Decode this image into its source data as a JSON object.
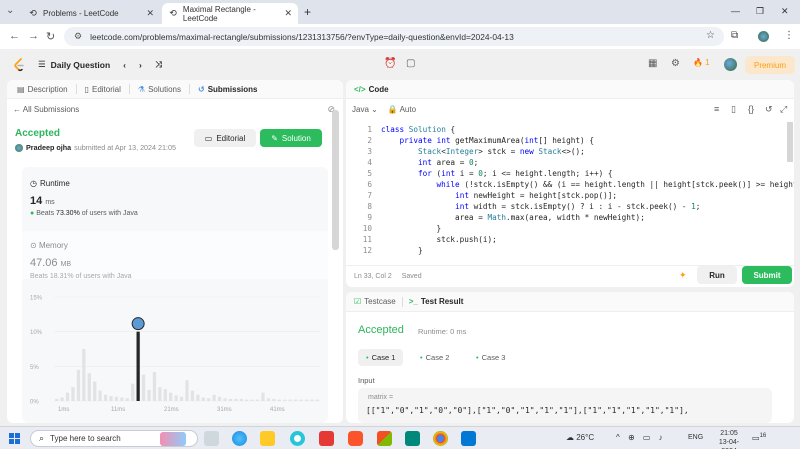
{
  "browser": {
    "tabs": [
      {
        "title": "Problems - LeetCode",
        "close": "✕"
      },
      {
        "title": "Maximal Rectangle - LeetCode",
        "close": "✕"
      }
    ],
    "new_tab": "+",
    "url": "leetcode.com/problems/maximal-rectangle/submissions/1231313756/?envType=daily-question&envId=2024-04-13"
  },
  "header": {
    "title": "Daily Question",
    "streak": "1",
    "premium": "Premium"
  },
  "left": {
    "tabs": [
      "Description",
      "Editorial",
      "Solutions",
      "Submissions"
    ],
    "all_submissions": "All Submissions",
    "status": "Accepted",
    "user": "Pradeep ojha",
    "submitted": "submitted at Apr 13, 2024 21:05",
    "editorial_btn": "Editorial",
    "solution_btn": "Solution",
    "runtime_label": "Runtime",
    "runtime_value": "14",
    "runtime_unit": "ms",
    "runtime_beats_prefix": "Beats",
    "runtime_beats_pct": "73.30%",
    "runtime_beats_suffix": "of users with Java",
    "memory_label": "Memory",
    "memory_value": "47.06",
    "memory_unit": "MB",
    "memory_beats": "Beats 18.31% of users with Java"
  },
  "chart_data": {
    "type": "bar",
    "y_ticks": [
      "15%",
      "10%",
      "5%",
      "0%"
    ],
    "ylim": [
      0,
      15
    ],
    "x_ticks": [
      "1ms",
      "11ms",
      "21ms",
      "31ms",
      "41ms"
    ],
    "values": [
      0.3,
      0.5,
      1.2,
      2.0,
      4.5,
      7.5,
      4.0,
      2.8,
      1.5,
      0.9,
      0.7,
      0.6,
      0.5,
      0.4,
      2.5,
      10.0,
      3.8,
      1.6,
      4.2,
      2.0,
      1.7,
      1.2,
      0.8,
      0.6,
      3.0,
      1.5,
      0.9,
      0.5,
      0.4,
      0.9,
      0.6,
      0.4,
      0.3,
      0.3,
      0.3,
      0.2,
      0.2,
      0.2,
      1.2,
      0.4,
      0.3,
      0.2,
      0.2,
      0.2,
      0.2,
      0.2,
      0.2,
      0.2,
      0.2
    ],
    "highlight_index": 15,
    "bar_color": "#e3e3e3",
    "highlight_color": "#262626"
  },
  "code": {
    "title": "Code",
    "language": "Java",
    "auto": "Auto",
    "lines": [
      "class Solution {",
      "    private int getMaximumArea(int[] height) {",
      "        Stack<Integer> stck = new Stack<>();",
      "        int area = 0;",
      "        for (int i = 0; i <= height.length; i++) {",
      "            while (!stck.isEmpty() && (i == height.length || height[stck.peek()] >= height[i]",
      "                int newHeight = height[stck.pop()];",
      "                int width = stck.isEmpty() ? i : i - stck.peek() - 1;",
      "                area = Math.max(area, width * newHeight);",
      "            }",
      "            stck.push(i);",
      "        }"
    ],
    "cursor": "Ln 33, Col 2",
    "saved": "Saved",
    "run": "Run",
    "submit": "Submit"
  },
  "test": {
    "tabs": [
      "Testcase",
      "Test Result"
    ],
    "status": "Accepted",
    "runtime": "Runtime: 0 ms",
    "cases": [
      "Case 1",
      "Case 2",
      "Case 3"
    ],
    "input_label": "Input",
    "var_label": "matrix =",
    "var_value": "[[\"1\",\"0\",\"1\",\"0\",\"0\"],[\"1\",\"0\",\"1\",\"1\",\"1\"],[\"1\",\"1\",\"1\",\"1\",\"1\"],"
  },
  "taskbar": {
    "search_placeholder": "Type here to search",
    "temp": "26°C",
    "lang": "ENG",
    "time": "21:05",
    "date": "13-04-2024",
    "notif_count": "16"
  },
  "colors": {
    "accent_green": "#2cbb5d",
    "accepted_green": "#2db55d",
    "premium_orange": "#ff9f0f"
  }
}
